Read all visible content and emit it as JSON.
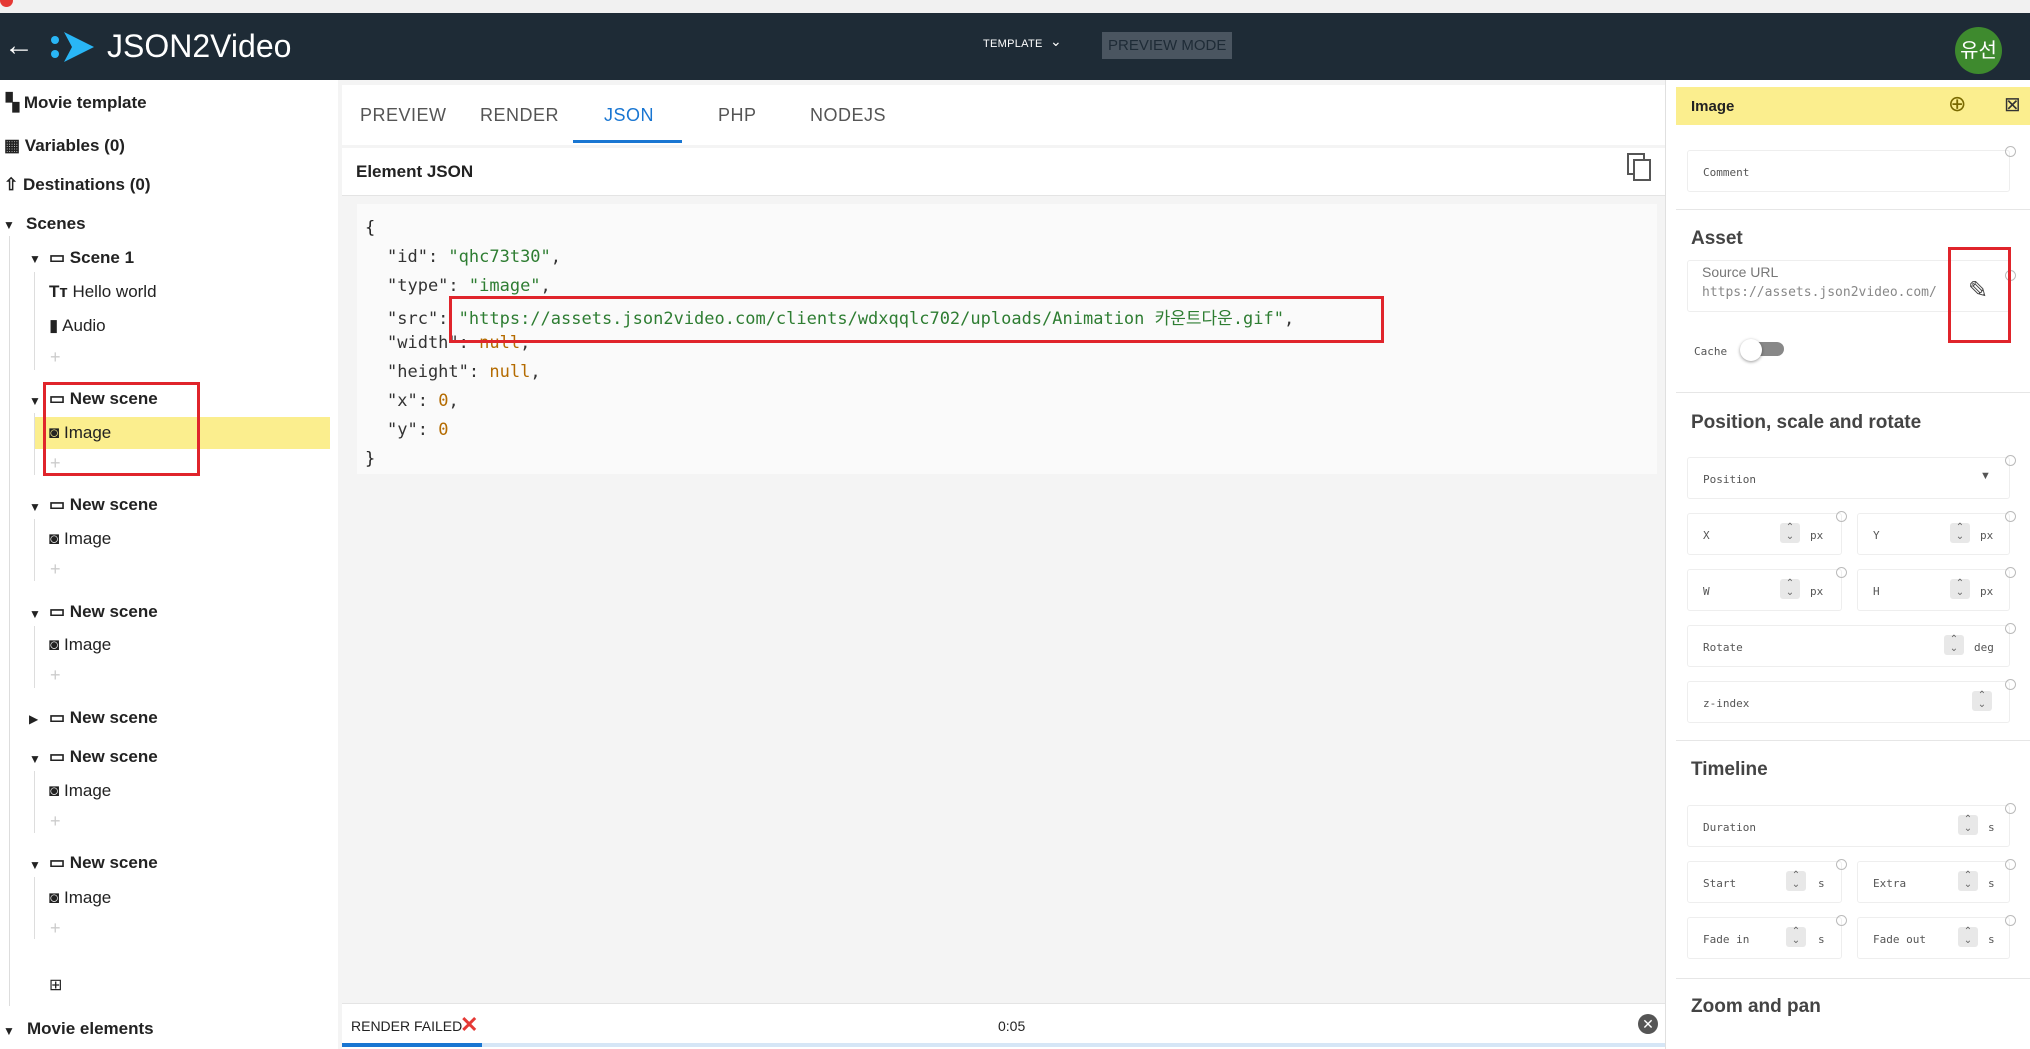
{
  "top": {
    "strip_text": ""
  },
  "app": {
    "brand": "JSON2Video",
    "template_label": "TEMPLATE",
    "preview_mode": "PREVIEW MODE",
    "avatar": "유선"
  },
  "tree": {
    "movie_template": "Movie template",
    "variables": "Variables (0)",
    "destinations": "Destinations (0)",
    "scenes": "Scenes",
    "scene1": "Scene 1",
    "hello": "Hello world",
    "audio": "Audio",
    "new_scene": "New scene",
    "image": "Image",
    "movie_elements": "Movie elements"
  },
  "tabs": [
    "PREVIEW",
    "RENDER",
    "JSON",
    "PHP",
    "NODEJS"
  ],
  "element_json": {
    "title": "Element JSON",
    "id": "\"qhc73t30\"",
    "type": "\"image\"",
    "src": "\"https://assets.json2video.com/clients/wdxqqlc702/uploads/Animation 카운트다운.gif\"",
    "width": "null",
    "height": "null",
    "x": "0",
    "y": "0"
  },
  "status": {
    "render": "RENDER FAILED",
    "time": "0:05"
  },
  "panel": {
    "title": "Image",
    "comment": "Comment",
    "asset": "Asset",
    "source_label": "Source URL",
    "source_value": "https://assets.json2video.com/",
    "cache": "Cache",
    "pos_section": "Position, scale and rotate",
    "position": "Position",
    "x": "X",
    "y": "Y",
    "w": "W",
    "h": "H",
    "px": "px",
    "rotate": "Rotate",
    "deg": "deg",
    "zindex": "z-index",
    "timeline": "Timeline",
    "duration": "Duration",
    "start": "Start",
    "extra": "Extra",
    "fadein": "Fade in",
    "fadeout": "Fade out",
    "s": "s",
    "zoom": "Zoom and pan"
  },
  "colors": {
    "appbar": "#1e2b36",
    "highlight": "#fbee8e",
    "accent": "#1976d2",
    "annotation": "#e0242b"
  }
}
